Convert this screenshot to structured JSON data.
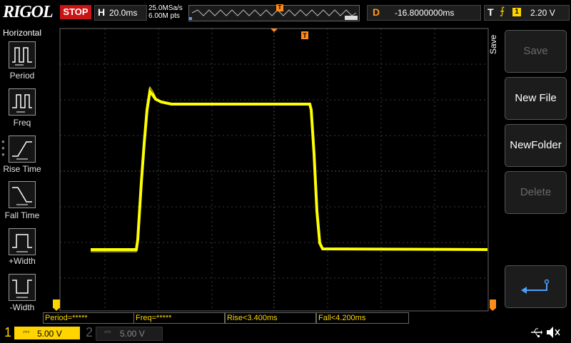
{
  "brand": "RIGOL",
  "run_state": "STOP",
  "horizontal": {
    "label": "H",
    "timebase": "20.0ms",
    "sample_rate": "25.0MSa/s",
    "memory_depth": "6.00M pts"
  },
  "delay": {
    "label": "D",
    "value": "-16.8000000ms"
  },
  "trigger": {
    "label": "T",
    "source": "1",
    "level": "2.20 V",
    "slope": "rising-edge"
  },
  "left_menu": {
    "title": "Horizontal",
    "items": [
      {
        "label": "Period",
        "icon": "period-icon"
      },
      {
        "label": "Freq",
        "icon": "frequency-icon"
      },
      {
        "label": "Rise Time",
        "icon": "rise-time-icon"
      },
      {
        "label": "Fall Time",
        "icon": "fall-time-icon"
      },
      {
        "label": "+Width",
        "icon": "positive-width-icon"
      },
      {
        "label": "-Width",
        "icon": "negative-width-icon"
      }
    ]
  },
  "right_menu": {
    "title": "Save",
    "items": [
      {
        "label": "Save",
        "enabled": false
      },
      {
        "label": "New File",
        "enabled": true
      },
      {
        "label": "NewFolder",
        "enabled": true
      },
      {
        "label": "Delete",
        "enabled": false
      }
    ],
    "back_icon": "return-arrow-icon"
  },
  "measurements": [
    {
      "text": "Period=*****"
    },
    {
      "text": "Freq=*****"
    },
    {
      "text": "Rise<3.400ms"
    },
    {
      "text": "Fall<4.200ms"
    }
  ],
  "channels": [
    {
      "number": "1",
      "scale": "5.00 V",
      "active": true,
      "color": "#ffd400"
    },
    {
      "number": "2",
      "scale": "5.00 V",
      "active": false,
      "color": "#5a5a5a"
    }
  ],
  "status_icons": [
    "usb-icon",
    "speaker-muted-icon"
  ],
  "colors": {
    "trace": "#ffff00",
    "stop": "#c81414",
    "trigger_marker": "#ff8c1a"
  }
}
